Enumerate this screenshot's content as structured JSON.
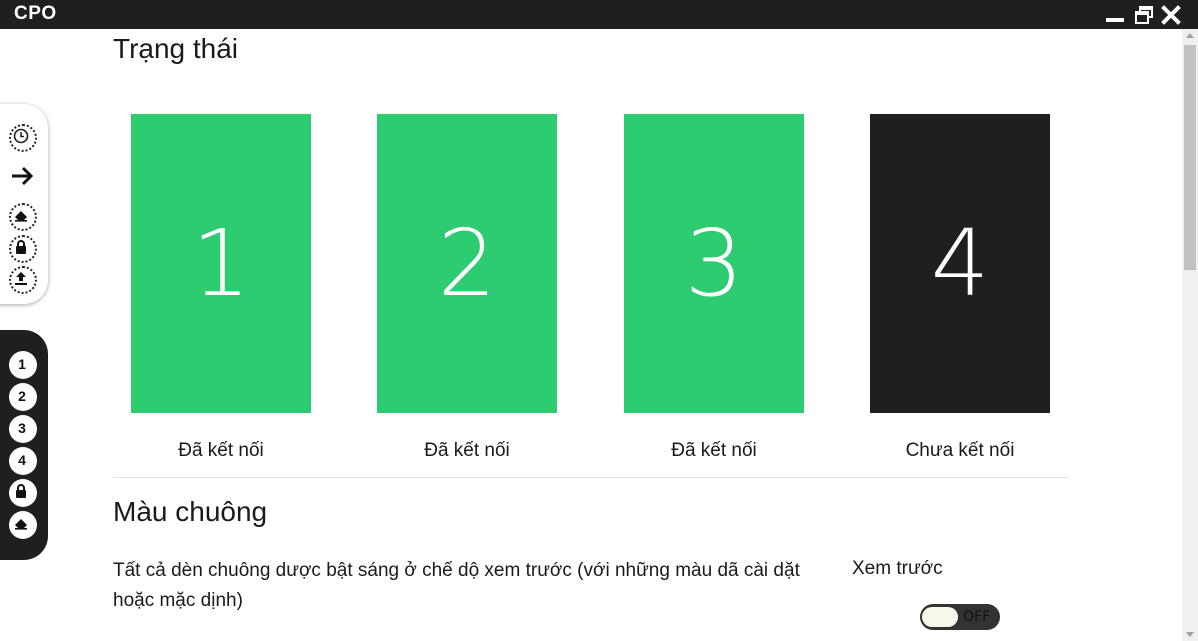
{
  "window": {
    "title": "CPO"
  },
  "status_section": {
    "title": "Trạng thái",
    "tiles": [
      {
        "number": "1",
        "label": "Đã kết nối",
        "color": "#2ecc71"
      },
      {
        "number": "2",
        "label": "Đã kết nối",
        "color": "#2ecc71"
      },
      {
        "number": "3",
        "label": "Đã kết nối",
        "color": "#2ecc71"
      },
      {
        "number": "4",
        "label": "Chưa kết nối",
        "color": "#1f1f1f"
      }
    ]
  },
  "bell_color_section": {
    "title": "Màu chuông",
    "description": "Tất cả dèn chuông dược bật sáng ở chế dộ xem trước (với những màu dã cài dặt hoặc mặc dịnh)",
    "preview_label": "Xem trước",
    "toggle": {
      "state": "OFF"
    }
  },
  "left_toolbar_top": [
    "clock-icon",
    "arrow-right-icon",
    "eraser-icon",
    "lock-icon",
    "upload-icon"
  ],
  "left_toolbar_bottom": {
    "numbers": [
      "1",
      "2",
      "3",
      "4"
    ],
    "icons": [
      "lock-icon",
      "eraser-icon"
    ]
  }
}
